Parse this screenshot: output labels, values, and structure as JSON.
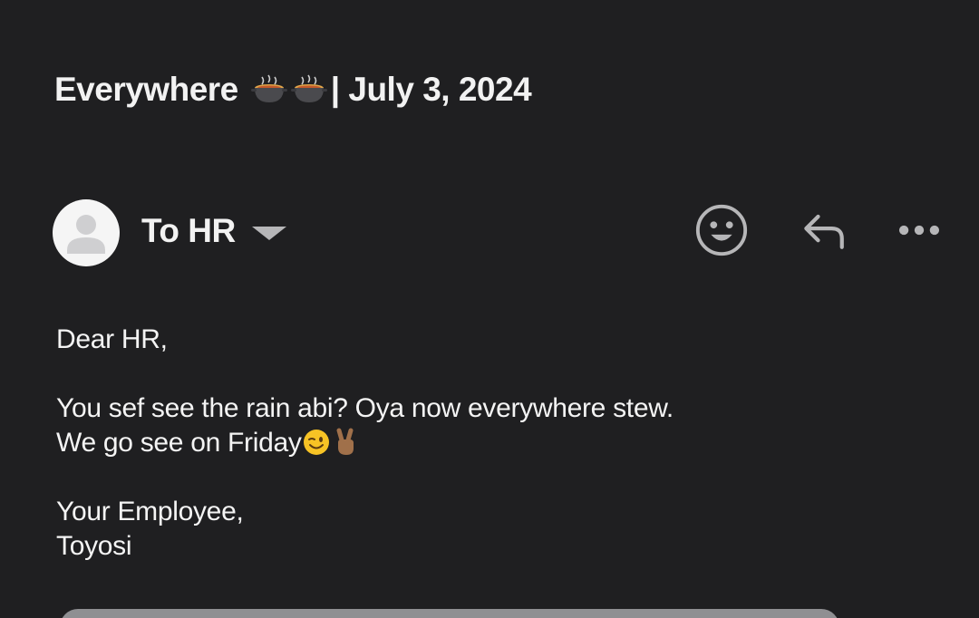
{
  "email": {
    "subject_prefix": "Everywhere",
    "subject_suffix": "| July 3, 2024",
    "recipient_label": "To HR",
    "body": {
      "greeting": "Dear HR,",
      "line1": "You sef see the rain abi? Oya now everywhere stew.",
      "line2": "We go see on Friday",
      "signoff": "Your Employee,",
      "signature": "Toyosi"
    }
  },
  "icons": {
    "subject_emoji": "pot-of-food-icon",
    "avatar": "default-avatar-icon",
    "recipient_toggle": "caret-down-icon",
    "react": "smiley-icon",
    "reply": "reply-arrow-icon",
    "more": "more-dots-icon",
    "wink": "winking-face-icon",
    "peace": "victory-hand-icon"
  },
  "colors": {
    "background": "#1f1f21",
    "text": "#f2f2f2",
    "icon": "#b6b6b8"
  }
}
